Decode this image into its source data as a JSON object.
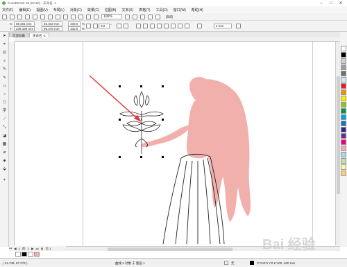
{
  "window": {
    "title": "CorelDRAW X8 (64-Bit) - 未命名 -1"
  },
  "menu": {
    "items": [
      "文件(F)",
      "编辑(E)",
      "视图(V)",
      "布局(L)",
      "对象(C)",
      "效果(C)",
      "位图(B)",
      "文本(X)",
      "表格(T)",
      "工具(O)",
      "窗口(W)",
      "帮助(H)"
    ]
  },
  "toolbar": {
    "zoom": "100%",
    "launch_label": "启动",
    "nudge": "2 mm"
  },
  "propbar": {
    "x_label": "X:",
    "x": "59.261 mm",
    "y_label": "Y:",
    "y": "208.189 mm",
    "w": "45.343 mm",
    "h": "96.478 mm",
    "sx": "100.0",
    "sy": "100.0",
    "pct1": "%",
    "pct2": "%",
    "rotation": "0.0",
    "deg": "°"
  },
  "tabs": [
    "欢迎屏幕",
    "未命名 -1"
  ],
  "pagenav": {
    "current": "1",
    "of": "的",
    "total": "1",
    "page_tab": "页 1"
  },
  "status": {
    "coords": "( 34.749, 87.274 )",
    "selection": "曲线 2 对象 于 图层 1",
    "fill_info": "C:0 M:0 Y:0 K:100  .200 mm",
    "none_label": "无"
  },
  "watermark": "Bai 经验",
  "colors": {
    "figure_fill": "#f2b0ad",
    "arrow": "#e53935",
    "accent": "#2a72c6"
  },
  "palette": [
    "#ffffff",
    "#000000",
    "#cfcfcf",
    "#9e9e9e",
    "#6e6e6e",
    "#d4e8f5",
    "#e31e24",
    "#f39200",
    "#ffed00",
    "#95c11f",
    "#009640",
    "#00a0e3",
    "#1d70b7",
    "#312783",
    "#6a2c91",
    "#e5007e",
    "#f7a8b8",
    "#a3d8f2",
    "#c2e0a4",
    "#fff59d",
    "#ffcc80"
  ]
}
